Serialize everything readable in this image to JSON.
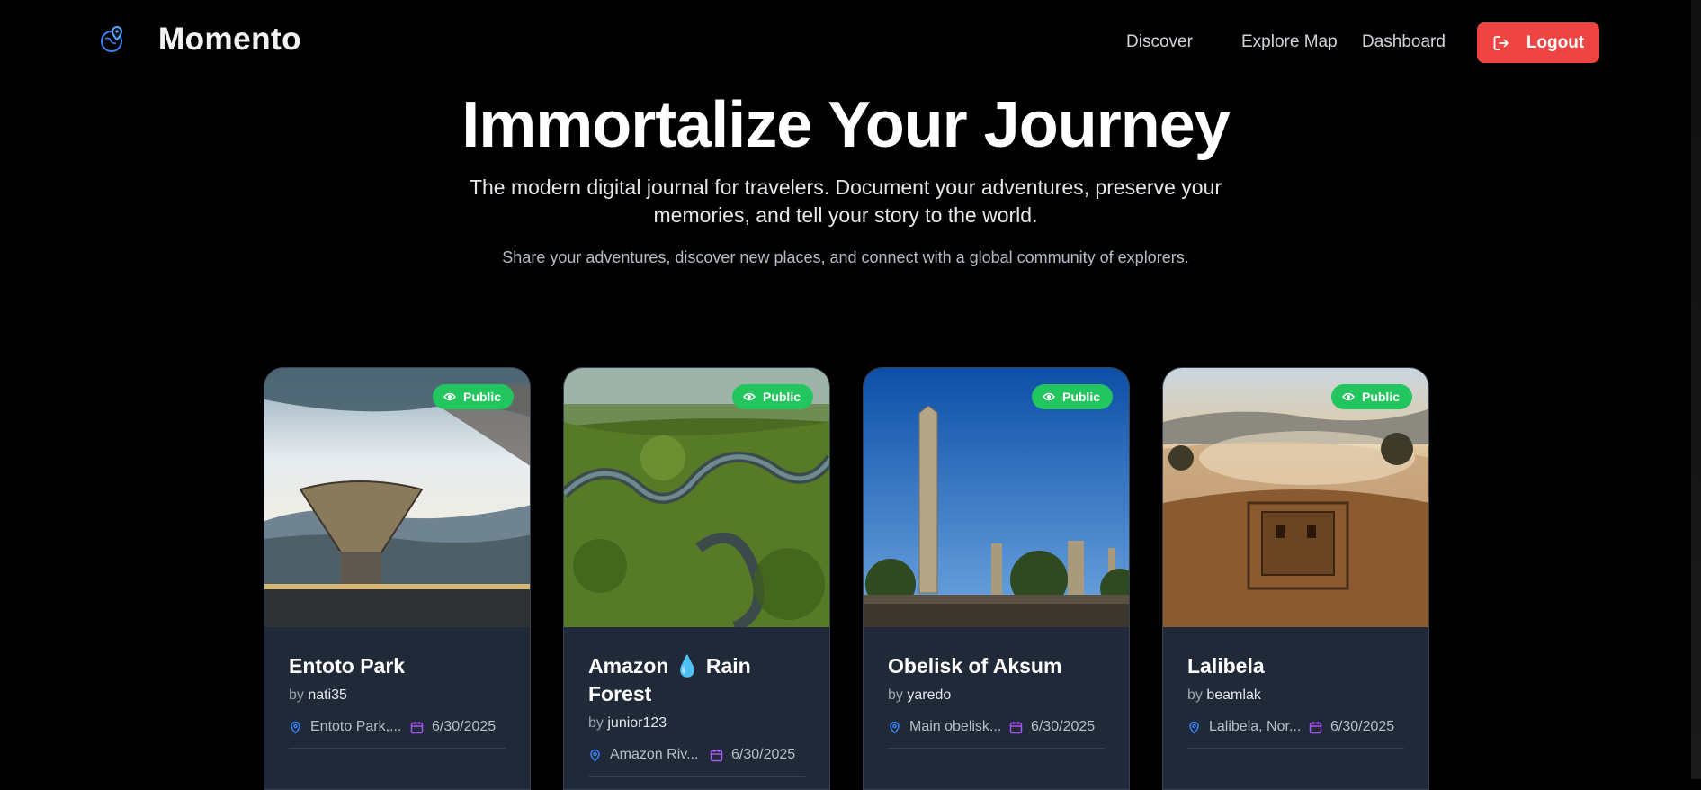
{
  "nav": {
    "brand": "Momento",
    "links": [
      "Discover",
      "Explore Map",
      "Dashboard"
    ],
    "logout_label": "Logout",
    "accent": "#ef4444"
  },
  "hero": {
    "title": "Immortalize Your Journey",
    "subtitle": "The modern digital journal for travelers. Document your adventures, preserve your memories, and tell your story to the world.",
    "tagline": "Share your adventures, discover new places, and connect with a global community of explorers."
  },
  "cards": [
    {
      "badge": "Public",
      "title": "Entoto Park",
      "by": "by",
      "author": "nati35",
      "location": "Entoto Park,...",
      "date": "6/30/2025"
    },
    {
      "badge": "Public",
      "title": "Amazon 💧 Rain Forest",
      "by": "by",
      "author": "junior123",
      "location": "Amazon Riv...",
      "date": "6/30/2025"
    },
    {
      "badge": "Public",
      "title": "Obelisk of Aksum",
      "by": "by",
      "author": "yaredo",
      "location": "Main obelisk...",
      "date": "6/30/2025"
    },
    {
      "badge": "Public",
      "title": "Lalibela",
      "by": "by",
      "author": "beamlak",
      "location": "Lalibela, Nor...",
      "date": "6/30/2025"
    }
  ],
  "colors": {
    "badge_green": "#22c55e",
    "card_bg": "#1f2937",
    "location_icon": "#3b82f6",
    "calendar_icon": "#a855f7"
  }
}
